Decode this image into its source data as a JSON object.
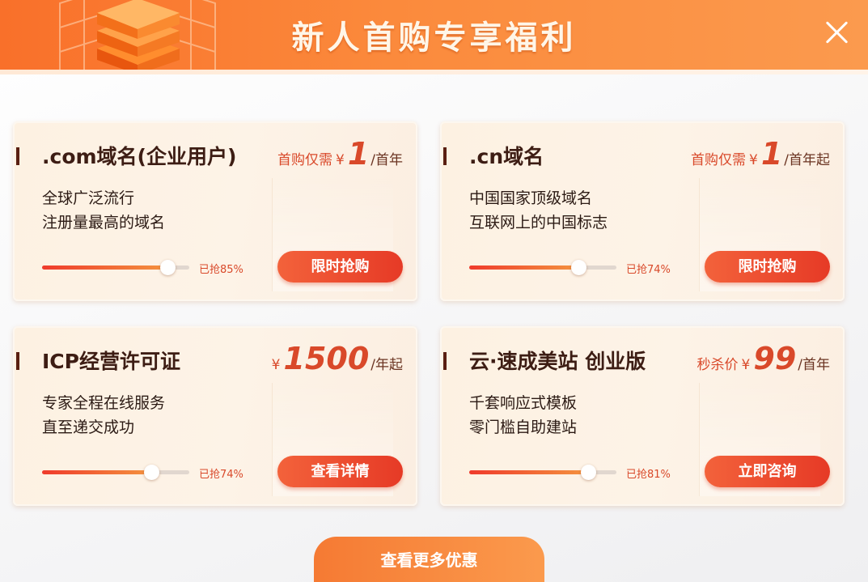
{
  "header": {
    "title": "新人首购专享福利",
    "close_icon": "close-icon"
  },
  "cards": [
    {
      "title": ".com域名(企业用户)",
      "price_prefix": "首购仅需",
      "currency": "¥",
      "price": "1",
      "price_suffix": "/首年",
      "desc_line1": "全球广泛流行",
      "desc_line2": "注册量最高的域名",
      "progress": 0.85,
      "progress_label": "已抢85%",
      "button": "限时抢购"
    },
    {
      "title": ".cn域名",
      "price_prefix": "首购仅需",
      "currency": "¥",
      "price": "1",
      "price_suffix": "/首年起",
      "desc_line1": "中国国家顶级域名",
      "desc_line2": "互联网上的中国标志",
      "progress": 0.74,
      "progress_label": "已抢74%",
      "button": "限时抢购"
    },
    {
      "title": "ICP经营许可证",
      "price_prefix": "",
      "currency": "¥",
      "price": "1500",
      "price_suffix": "/年起",
      "desc_line1": "专家全程在线服务",
      "desc_line2": "直至递交成功",
      "progress": 0.74,
      "progress_label": "已抢74%",
      "button": "查看详情"
    },
    {
      "title": "云·速成美站 创业版",
      "price_prefix": "秒杀价",
      "currency": "¥",
      "price": "99",
      "price_suffix": "/首年",
      "desc_line1": "千套响应式模板",
      "desc_line2": "零门槛自助建站",
      "progress": 0.81,
      "progress_label": "已抢81%",
      "button": "立即咨询"
    }
  ],
  "footer": {
    "more_button": "查看更多优惠"
  },
  "colors": {
    "accent": "#f9702a",
    "price": "#d9492a",
    "title": "#3d1d14"
  }
}
